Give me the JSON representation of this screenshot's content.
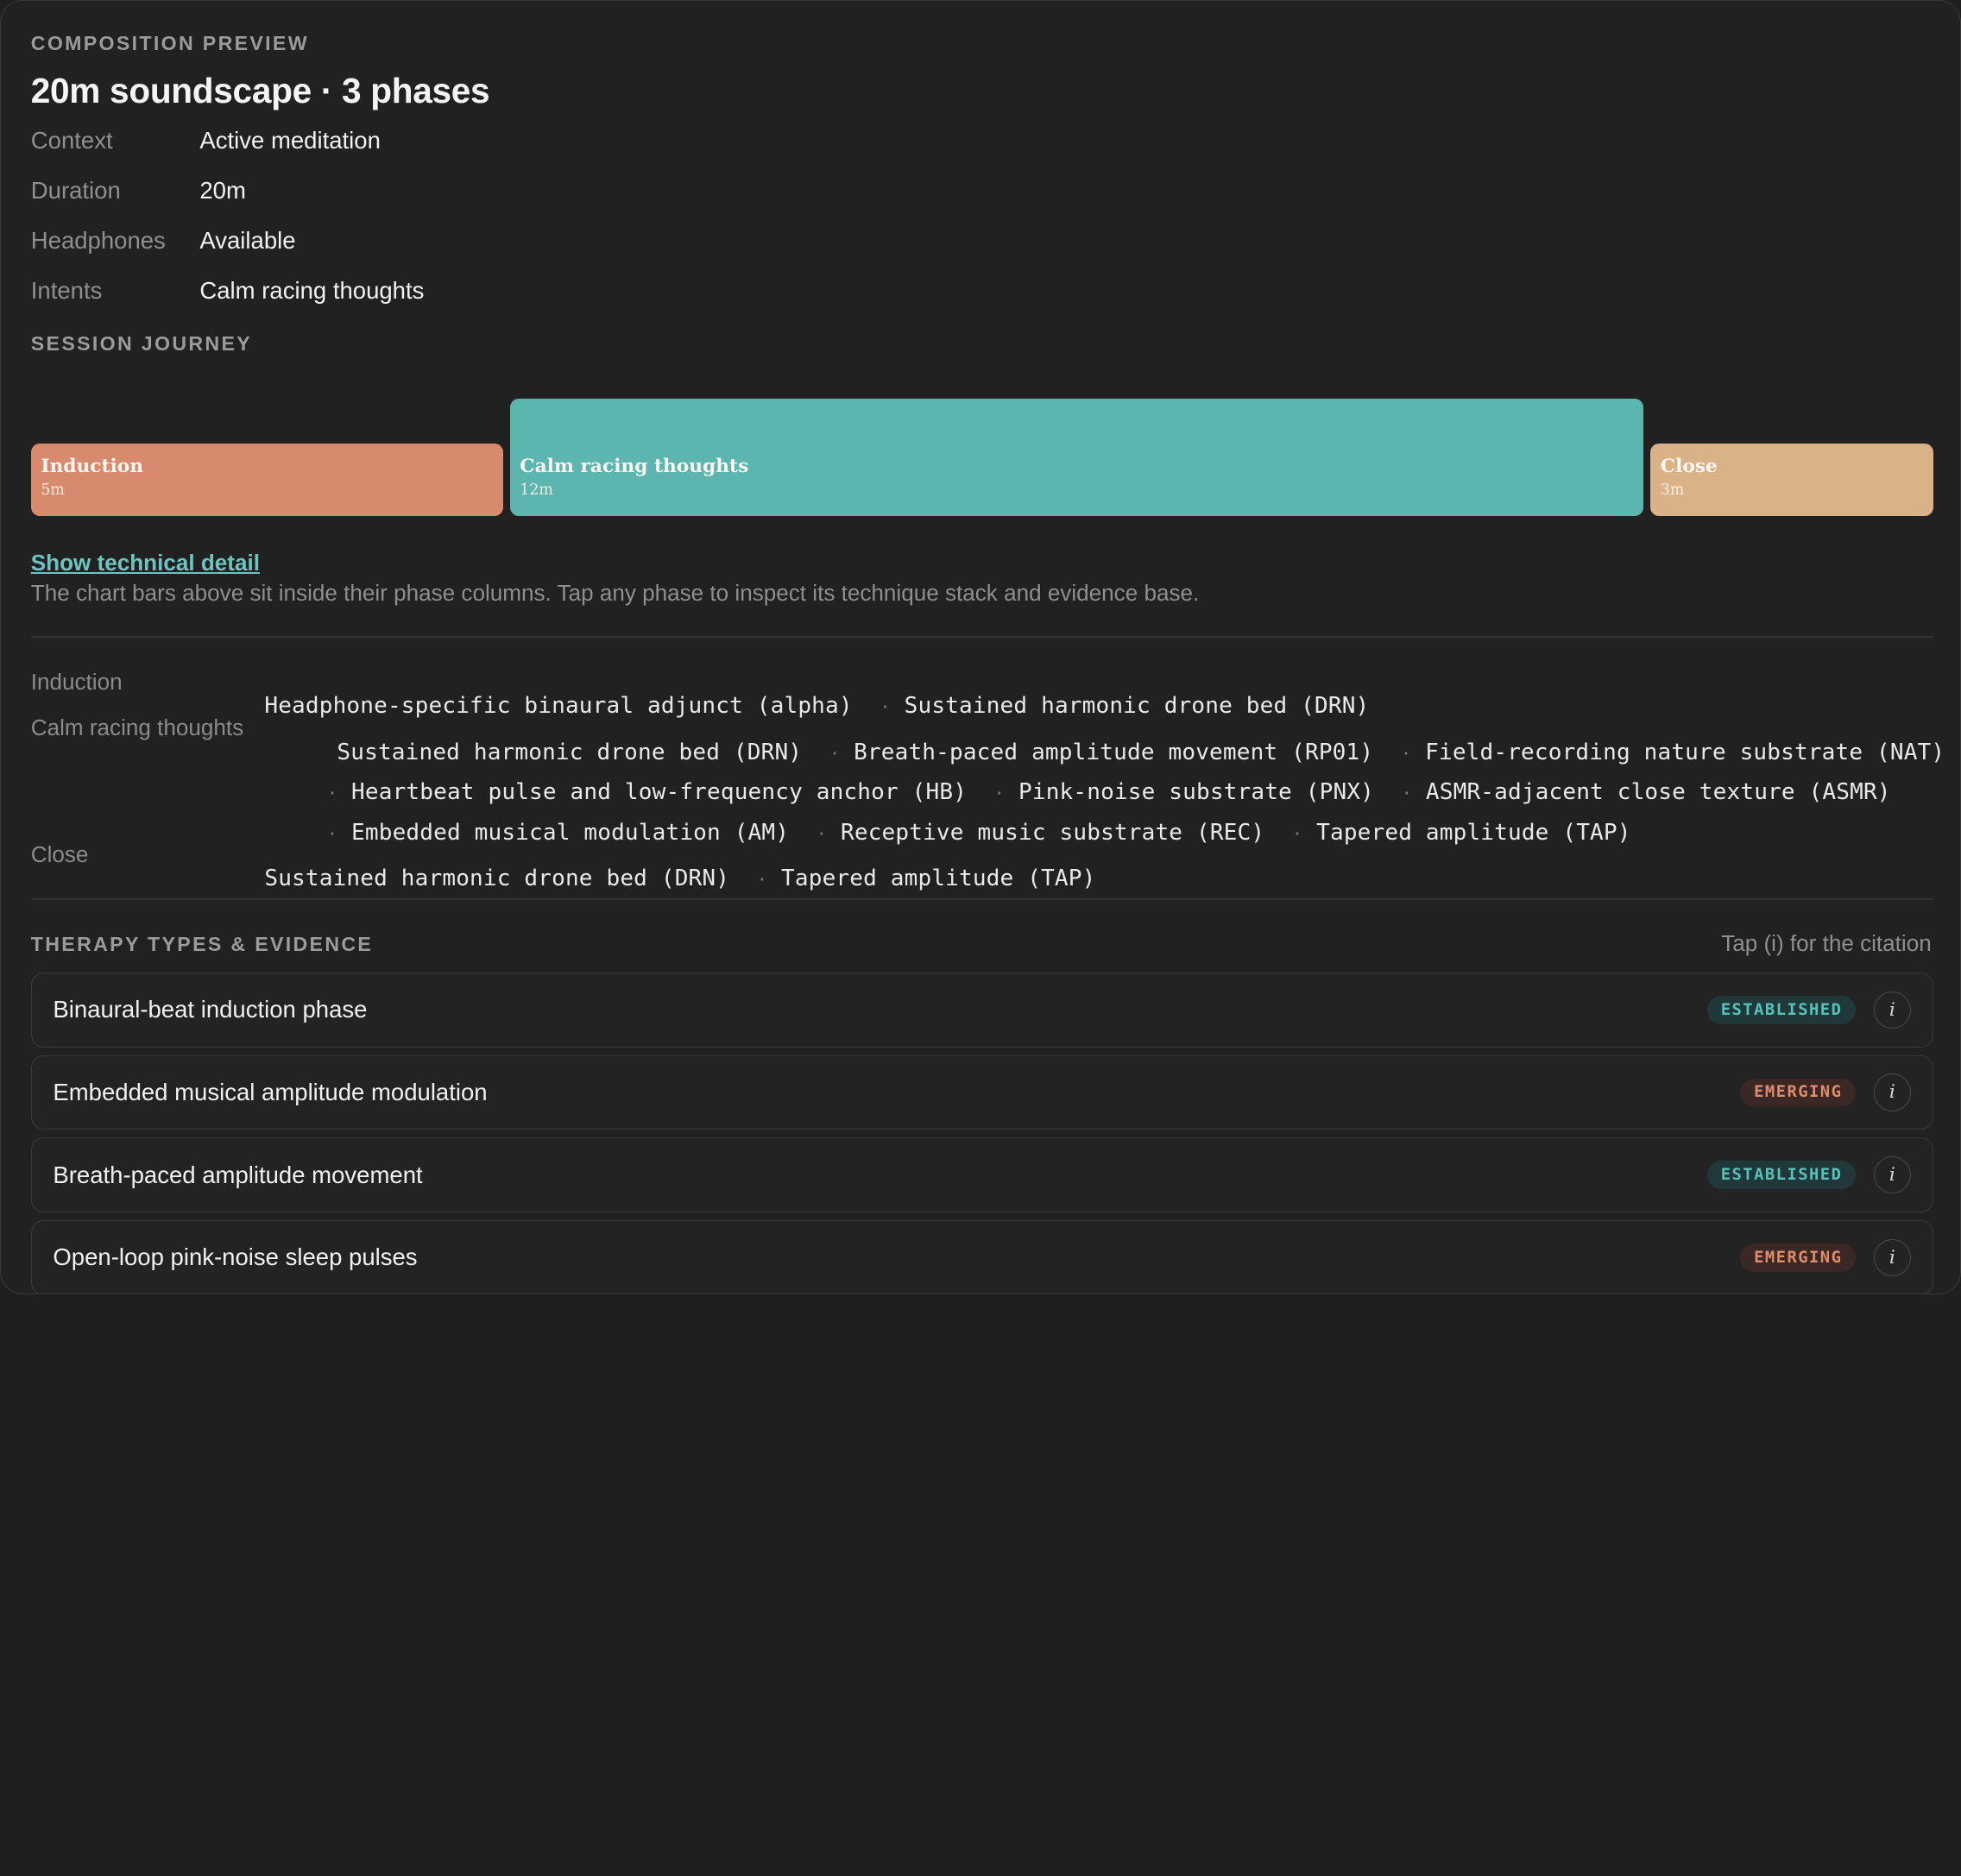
{
  "header": {
    "eyebrow": "COMPOSITION PREVIEW",
    "title": "20m soundscape · 3 phases"
  },
  "meta": [
    {
      "key": "Context",
      "value": "Active meditation"
    },
    {
      "key": "Duration",
      "value": "20m"
    },
    {
      "key": "Headphones",
      "value": "Available"
    },
    {
      "key": "Intents",
      "value": "Calm racing thoughts"
    }
  ],
  "journey": {
    "eyebrow": "SESSION JOURNEY",
    "phases": [
      {
        "name": "Induction",
        "duration": "5m",
        "color": "#d78a6d"
      },
      {
        "name": "Calm racing thoughts",
        "duration": "12m",
        "color": "#5db5af"
      },
      {
        "name": "Close",
        "duration": "3m",
        "color": "#d9b288"
      }
    ]
  },
  "technical": {
    "link": "Show technical detail",
    "hint": "The chart bars above sit inside their phase columns. Tap any phase to inspect its technique stack and evidence base.",
    "separator": "·",
    "rows": [
      {
        "label": "Induction",
        "lines": [
          [
            "Headphone-specific binaural adjunct (alpha)",
            "Sustained harmonic drone bed (DRN)"
          ]
        ]
      },
      {
        "label": "Calm racing thoughts",
        "lines": [
          [
            "Sustained harmonic drone bed (DRN)",
            "Breath-paced amplitude movement (RP01)",
            "Field-recording nature substrate (NAT)"
          ],
          [
            "Heartbeat pulse and low-frequency anchor (HB)",
            "Pink-noise substrate (PNX)",
            "ASMR-adjacent close texture (ASMR)"
          ],
          [
            "Embedded musical modulation (AM)",
            "Receptive music substrate (REC)",
            "Tapered amplitude (TAP)"
          ]
        ]
      },
      {
        "label": "Close",
        "lines": [
          [
            "Sustained harmonic drone bed (DRN)",
            "Tapered amplitude (TAP)"
          ]
        ]
      }
    ]
  },
  "evidence": {
    "eyebrow": "THERAPY TYPES & EVIDENCE",
    "hint": "Tap (i) for the citation",
    "info_glyph": "i",
    "items": [
      {
        "title": "Binaural-beat induction phase",
        "badge": "ESTABLISHED",
        "level": "established"
      },
      {
        "title": "Embedded musical amplitude modulation",
        "badge": "EMERGING",
        "level": "emerging"
      },
      {
        "title": "Breath-paced amplitude movement",
        "badge": "ESTABLISHED",
        "level": "established"
      },
      {
        "title": "Open-loop pink-noise sleep pulses",
        "badge": "EMERGING",
        "level": "emerging"
      }
    ]
  }
}
